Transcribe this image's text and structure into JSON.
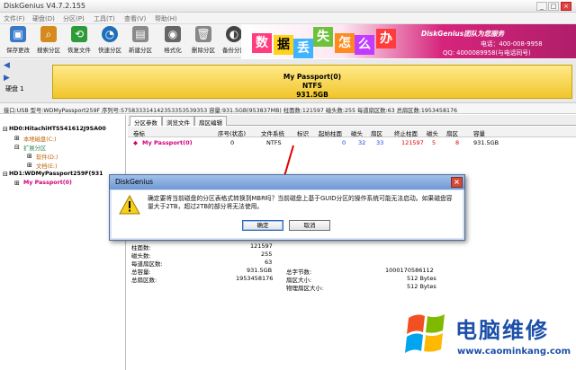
{
  "window": {
    "title": "DiskGenius V4.7.2.155",
    "controls": [
      "_",
      "□",
      "×"
    ]
  },
  "menu": [
    "文件(F)",
    "硬盘(D)",
    "分区(P)",
    "工具(T)",
    "查看(V)",
    "帮助(H)"
  ],
  "toolbar": [
    {
      "label": "保存更改",
      "icon": "save-icon",
      "color": "#3a78c9"
    },
    {
      "label": "搜索分区",
      "icon": "search-icon",
      "color": "#d48a1f"
    },
    {
      "label": "恢复文件",
      "icon": "recover-icon",
      "color": "#2e9a3a"
    },
    {
      "label": "快速分区",
      "icon": "quick-partition-icon",
      "color": "#1f6fb8"
    },
    {
      "label": "新建分区",
      "icon": "new-partition-icon",
      "color": "#8a8a8a"
    },
    {
      "label": "格式化",
      "icon": "format-icon",
      "color": "#666666"
    },
    {
      "label": "删除分区",
      "icon": "delete-icon",
      "color": "#888888"
    },
    {
      "label": "备份分区",
      "icon": "backup-icon",
      "color": "#444444"
    }
  ],
  "banner": {
    "chars": [
      "数",
      "据",
      "丢",
      "失",
      "怎",
      "么",
      "办"
    ],
    "brand": "DiskGenius团队为您服务",
    "phone": "电话：400-008-9958",
    "qq": "QQ: 4000089958(与电话同号)"
  },
  "disk_bar": {
    "label": "硬盘 1",
    "name": "My Passport(0)",
    "fs": "NTFS",
    "size": "931.5GB"
  },
  "info_bar": "接口:USB  型号:WDMyPassport259F  序列号:575833314142353353539353  容量:931.5GB(953837MB)  柱面数:121597  磁头数:255  每道扇区数:63  总扇区数:1953458176",
  "tree": [
    {
      "text": "HD0:HitachiHTS541612J9SA00",
      "color": "#000000"
    },
    {
      "text": "本地磁盘(C:)",
      "color": "#c06000"
    },
    {
      "text": "扩展分区",
      "color": "#2e8b57"
    },
    {
      "text": "软件(D:)",
      "color": "#c06000"
    },
    {
      "text": "文档(E:)",
      "color": "#c06000"
    },
    {
      "text": "HD1:WDMyPassport259F(931",
      "color": "#000000"
    },
    {
      "text": "My Passport(0)",
      "color": "#d0007a"
    }
  ],
  "tabs": [
    "分区参数",
    "浏览文件",
    "扇区编辑"
  ],
  "table": {
    "headers": [
      "卷标",
      "序号(状态)",
      "文件系统",
      "标识",
      "起始柱面",
      "磁头",
      "扇区",
      "终止柱面",
      "磁头",
      "扇区",
      "容量"
    ],
    "row": [
      "My Passport(0)",
      "0",
      "NTFS",
      "",
      "0",
      "32",
      "33",
      "121597",
      "5",
      "8",
      "931.5GB"
    ]
  },
  "stats_left": [
    {
      "k": "柱面数:",
      "v": "121597"
    },
    {
      "k": "磁头数:",
      "v": "255"
    },
    {
      "k": "每道扇区数:",
      "v": "63"
    },
    {
      "k": "总容量:",
      "v": "931.5GB"
    },
    {
      "k": "总扇区数:",
      "v": "1953458176"
    }
  ],
  "stats_right": [
    {
      "k": "总字节数:",
      "v": "1000170586112"
    },
    {
      "k": "扇区大小:",
      "v": "512 Bytes"
    },
    {
      "k": "物理扇区大小:",
      "v": "512 Bytes"
    }
  ],
  "dialog": {
    "title": "DiskGenius",
    "message": "确定要将当前磁盘的分区表格式转换到MBR吗？当前磁盘上基于GUID分区的操作系统可能无法启动。如果磁盘容量大于2TB，超过2TB的部分将无法使用。",
    "ok": "确定",
    "cancel": "取消"
  },
  "watermark": {
    "title": "电脑维修",
    "url": "www.caominkang.com"
  }
}
